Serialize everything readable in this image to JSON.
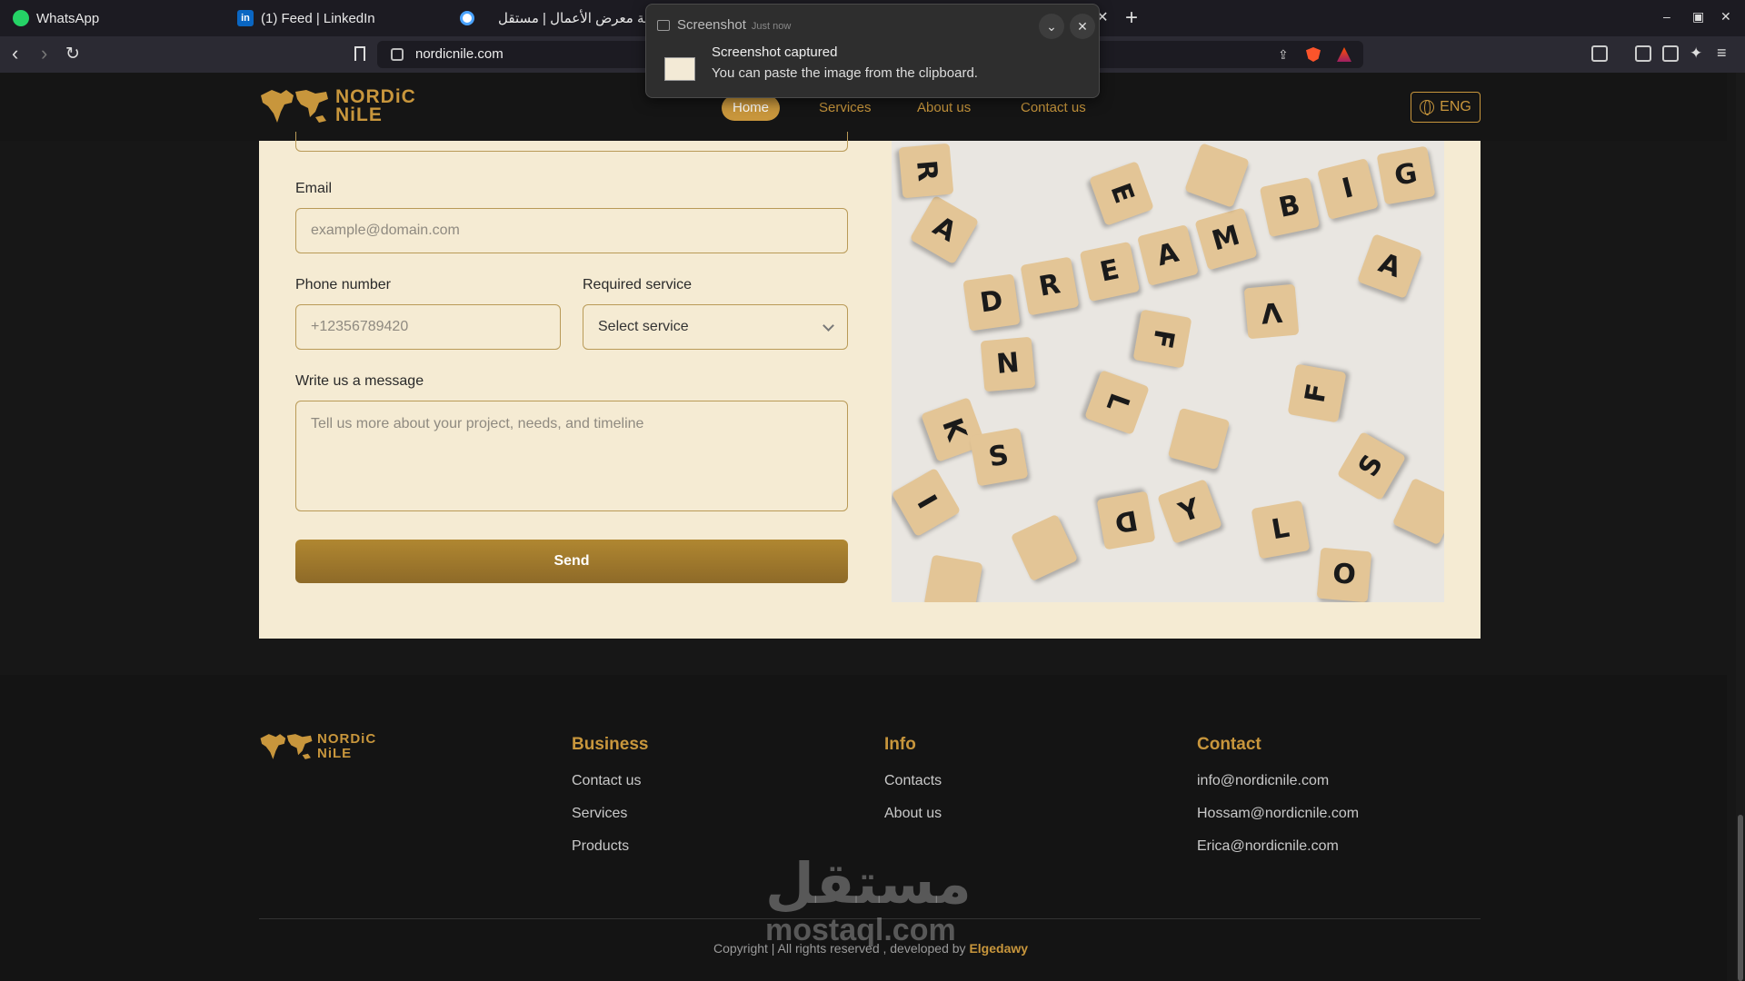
{
  "browser": {
    "tabs": [
      {
        "label": "WhatsApp",
        "icon": "whatsapp-icon"
      },
      {
        "label": "(1) Feed | LinkedIn",
        "icon": "linkedin-icon"
      },
      {
        "label": "إضافة معرض الأعمال | مستقل",
        "icon": "mostaql-icon"
      }
    ],
    "url": "nordicnile.com"
  },
  "notification": {
    "app": "Screenshot",
    "time": "Just now",
    "title": "Screenshot captured",
    "body": "You can paste the image from the clipboard."
  },
  "site": {
    "logo": {
      "line1": "NORDiC",
      "line2": "NiLE"
    },
    "nav": [
      {
        "label": "Home",
        "active": true
      },
      {
        "label": "Services",
        "active": false
      },
      {
        "label": "About us",
        "active": false
      },
      {
        "label": "Contact us",
        "active": false
      }
    ],
    "language": "ENG"
  },
  "form": {
    "email_label": "Email",
    "email_placeholder": "example@domain.com",
    "phone_label": "Phone number",
    "phone_placeholder": "+12356789420",
    "service_label": "Required service",
    "service_value": "Select service",
    "message_label": "Write us a message",
    "message_placeholder": "Tell us more about your project, needs, and timeline",
    "send_label": "Send"
  },
  "footer": {
    "columns": [
      {
        "title": "Business",
        "links": [
          "Contact us",
          "Services",
          "Products"
        ]
      },
      {
        "title": "Info",
        "links": [
          "Contacts",
          "About us"
        ]
      },
      {
        "title": "Contact",
        "links": [
          "info@nordicnile.com",
          "Hossam@nordicnile.com",
          "Erica@nordicnile.com"
        ]
      }
    ],
    "copyright_prefix": "Copyright | All rights reserved , developed by",
    "developer": "Elgedawy"
  },
  "watermark": {
    "arabic": "مستقل",
    "latin": "mostaql.com"
  },
  "colors": {
    "accent": "#c8963c",
    "card_bg": "#f5ebd3",
    "page_bg": "#171717"
  }
}
